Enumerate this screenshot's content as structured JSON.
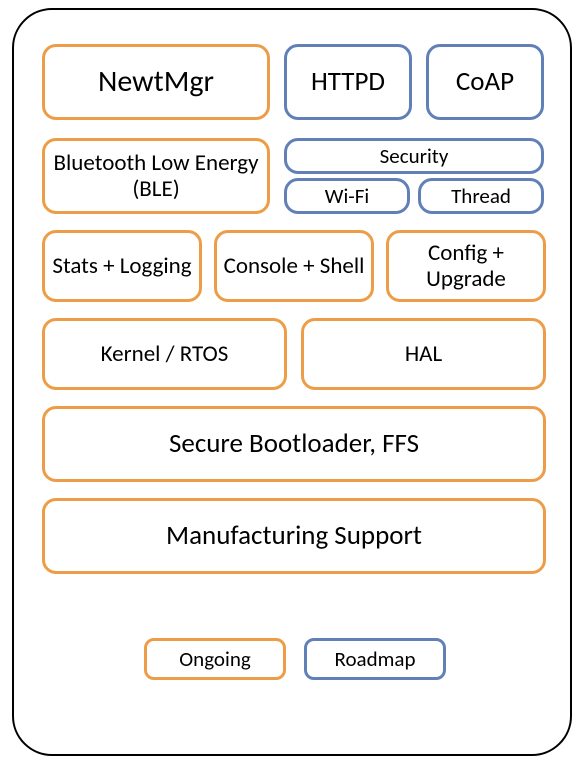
{
  "row1": {
    "newtmgr": "NewtMgr",
    "httpd": "HTTPD",
    "coap": "CoAP"
  },
  "row2": {
    "ble": "Bluetooth Low Energy (BLE)",
    "security": "Security",
    "wifi": "Wi-Fi",
    "thread": "Thread"
  },
  "row3": {
    "stats": "Stats + Logging",
    "console": "Console + Shell",
    "config": "Config + Upgrade"
  },
  "row4": {
    "kernel": "Kernel / RTOS",
    "hal": "HAL"
  },
  "row5": {
    "boot": "Secure Bootloader, FFS"
  },
  "row6": {
    "mfg": "Manufacturing Support"
  },
  "legend": {
    "ongoing": "Ongoing",
    "roadmap": "Roadmap"
  },
  "colors": {
    "ongoing": "#ed9d47",
    "roadmap": "#6180b8"
  }
}
